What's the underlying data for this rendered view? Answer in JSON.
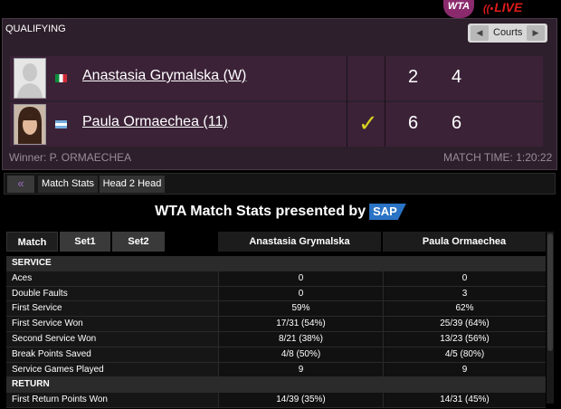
{
  "header": {
    "brand": "WTA",
    "live": "LIVE",
    "live_signal": "((•"
  },
  "scoreboard": {
    "round": "QUALIFYING",
    "courts_label": "Courts",
    "prev_icon": "◀",
    "next_icon": "▶",
    "players": [
      {
        "name": "Anastasia Grymalska (W)",
        "flag": "italy-flag",
        "sets": [
          "2",
          "4"
        ],
        "winner": false
      },
      {
        "name": "Paula Ormaechea (11)",
        "flag": "argentina-flag",
        "sets": [
          "6",
          "6"
        ],
        "winner": true
      }
    ],
    "check_icon": "✓",
    "winner_text": "Winner: P. ORMAECHEA",
    "match_time": "MATCH TIME: 1:20:22"
  },
  "tabs": {
    "back_icon": "«",
    "items": [
      "Match Stats",
      "Head 2 Head"
    ]
  },
  "stats": {
    "title": "WTA Match Stats presented by",
    "sponsor": "SAP",
    "set_buttons": [
      "Match",
      "Set1",
      "Set2"
    ],
    "columns": [
      "Anastasia Grymalska",
      "Paula Ormaechea"
    ],
    "rows": [
      {
        "label": "SERVICE",
        "p1": "",
        "p2": "",
        "section": true
      },
      {
        "label": "Aces",
        "p1": "0",
        "p2": "0"
      },
      {
        "label": "Double Faults",
        "p1": "0",
        "p2": "3"
      },
      {
        "label": "First Service",
        "p1": "59%",
        "p2": "62%"
      },
      {
        "label": "First Service Won",
        "p1": "17/31 (54%)",
        "p2": "25/39 (64%)"
      },
      {
        "label": "Second Service Won",
        "p1": "8/21 (38%)",
        "p2": "13/23 (56%)"
      },
      {
        "label": "Break Points Saved",
        "p1": "4/8 (50%)",
        "p2": "4/5 (80%)"
      },
      {
        "label": "Service Games Played",
        "p1": "9",
        "p2": "9"
      },
      {
        "label": "RETURN",
        "p1": "",
        "p2": "",
        "section": true
      },
      {
        "label": "First Return Points Won",
        "p1": "14/39 (35%)",
        "p2": "14/31 (45%)"
      }
    ]
  },
  "colors": {
    "accent": "#8c2a6e",
    "live": "#e01b1b",
    "check": "#d7d41e",
    "sap": "#2a73c5"
  }
}
